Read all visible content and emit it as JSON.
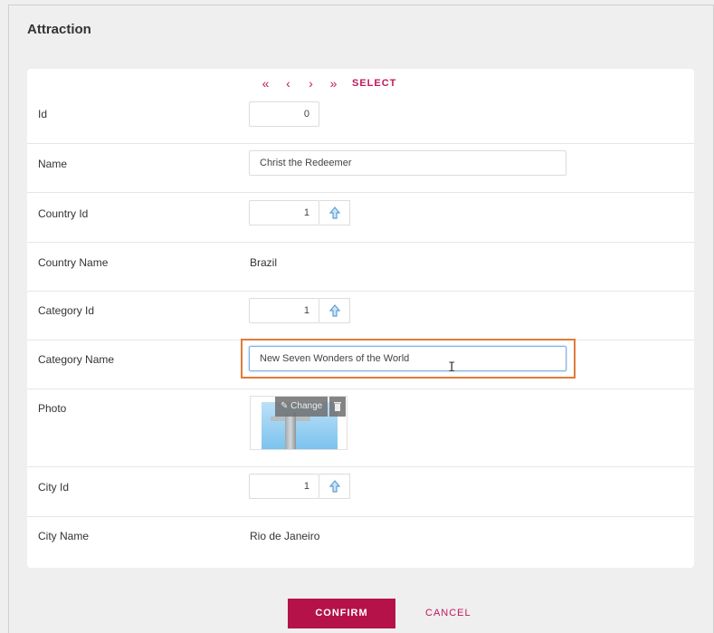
{
  "title": "Attraction",
  "nav": {
    "first": "«",
    "prev": "‹",
    "next": "›",
    "last": "»",
    "select": "SELECT"
  },
  "fields": {
    "id": {
      "label": "Id",
      "value": "0"
    },
    "name": {
      "label": "Name",
      "value": "Christ the Redeemer"
    },
    "country_id": {
      "label": "Country Id",
      "value": "1"
    },
    "country_name": {
      "label": "Country Name",
      "value": "Brazil"
    },
    "category_id": {
      "label": "Category Id",
      "value": "1"
    },
    "category_name": {
      "label": "Category Name",
      "value": "New Seven Wonders of the World"
    },
    "photo": {
      "label": "Photo",
      "change": "Change"
    },
    "city_id": {
      "label": "City Id",
      "value": "1"
    },
    "city_name": {
      "label": "City Name",
      "value": "Rio de Janeiro"
    }
  },
  "actions": {
    "confirm": "CONFIRM",
    "cancel": "CANCEL"
  },
  "colors": {
    "accent": "#c2185b",
    "confirm_bg": "#b5124a",
    "focus_outline": "#e07b39",
    "prompt_icon": "#5aa0d8"
  },
  "icons": {
    "prompt": "upload-arrow-icon",
    "change": "pencil-icon",
    "delete": "trash-icon",
    "cursor": "text-cursor-icon"
  }
}
